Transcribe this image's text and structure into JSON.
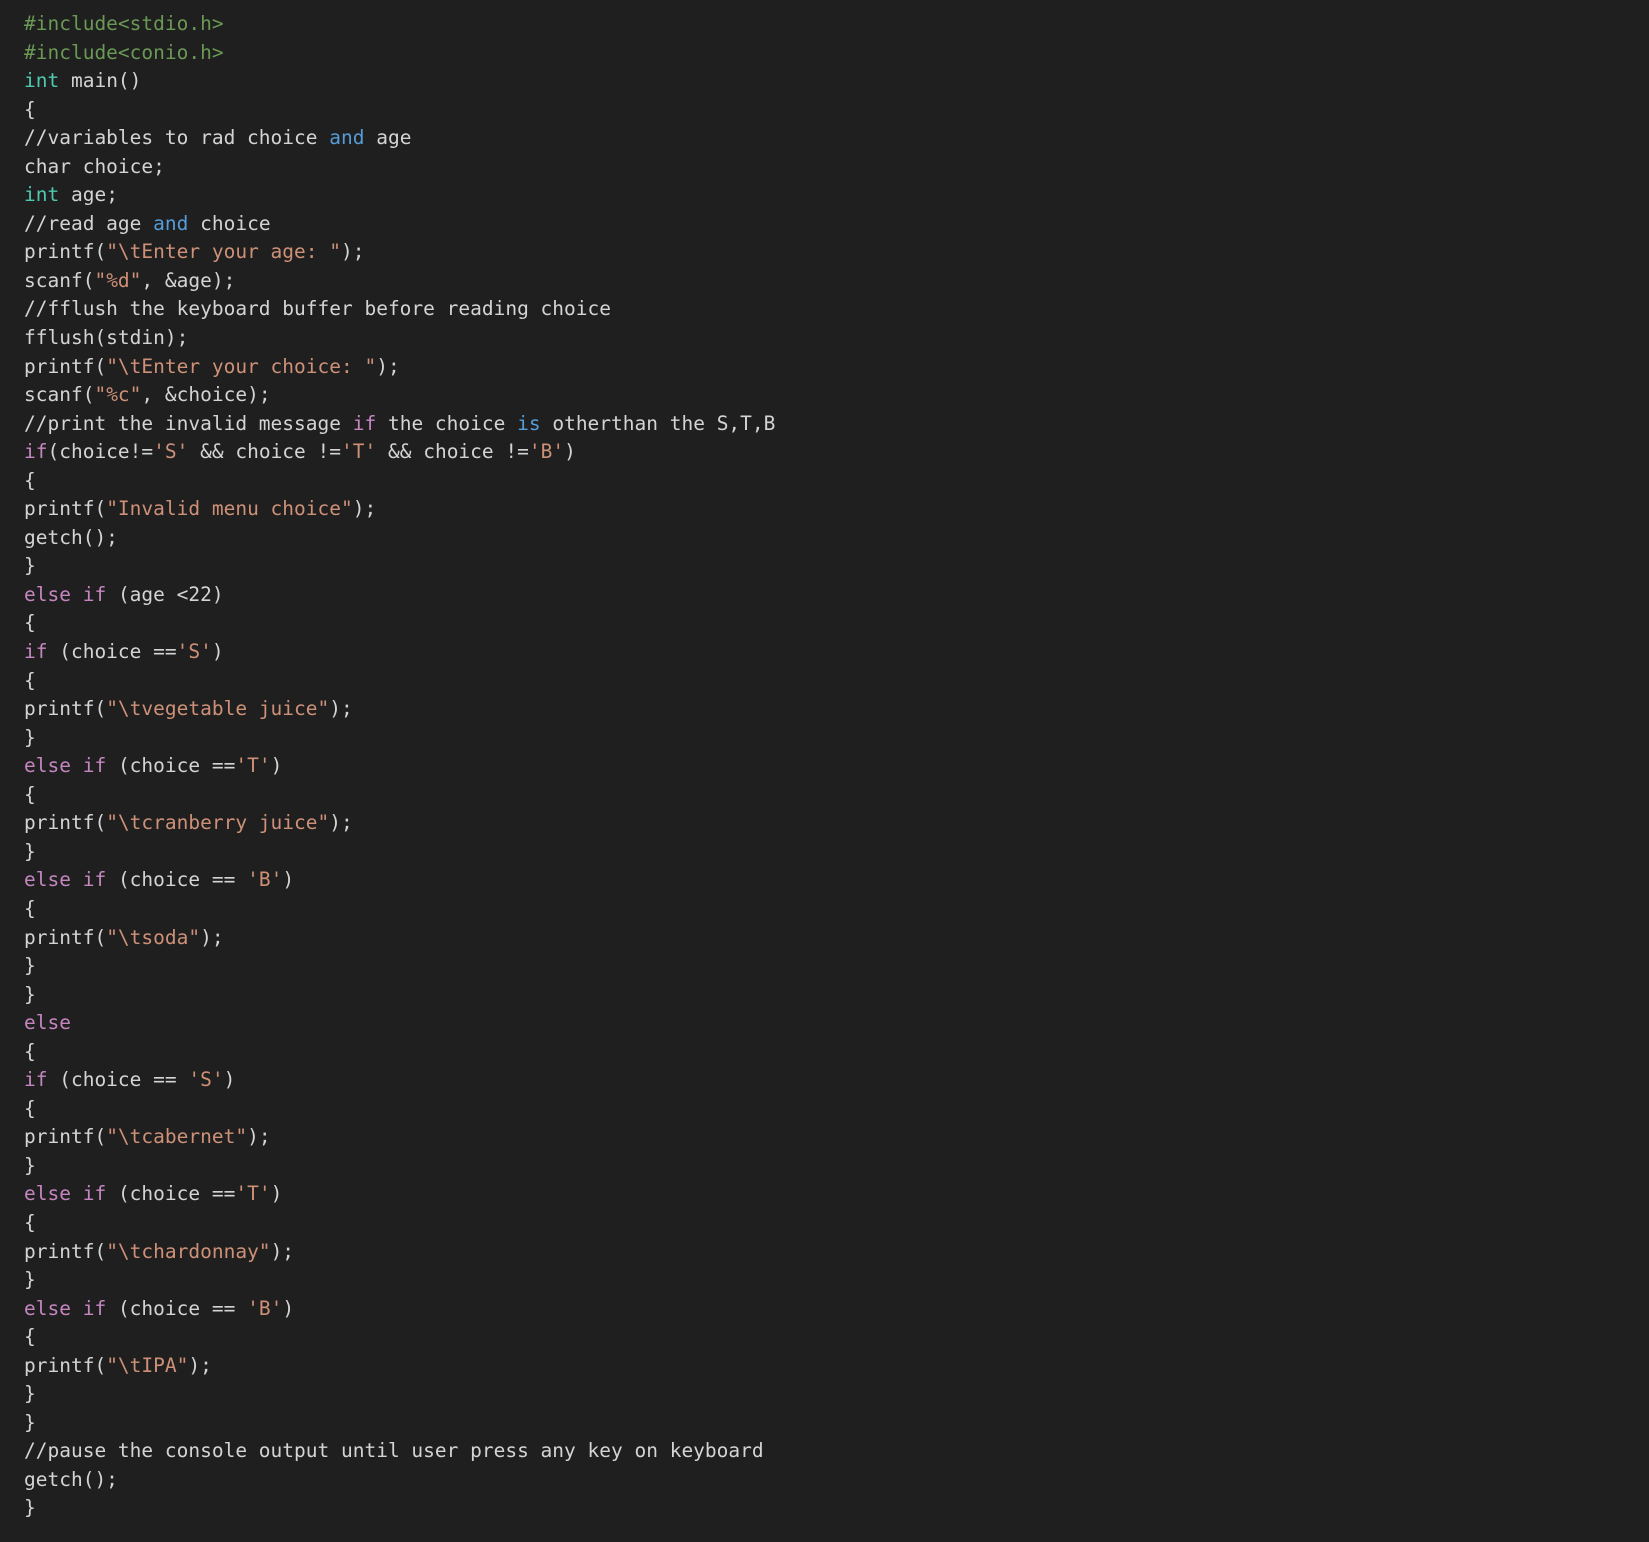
{
  "theme": {
    "background": "#1f1f1f",
    "default_text": "#d4d4d4",
    "preprocessor": "#6a9955",
    "type": "#4ec9b0",
    "keyword": "#c586c0",
    "word_operator": "#569cd6",
    "string": "#ce9178"
  },
  "code_lines": [
    [
      {
        "t": "#include<stdio.h>",
        "k": "preproc"
      }
    ],
    [
      {
        "t": "#include<conio.h>",
        "k": "preproc"
      }
    ],
    [
      {
        "t": "int",
        "k": "type"
      },
      {
        "t": " main()",
        "k": "plain"
      }
    ],
    [
      {
        "t": "{",
        "k": "plain"
      }
    ],
    [
      {
        "t": "//variables to rad choice ",
        "k": "plain"
      },
      {
        "t": "and",
        "k": "operator-word"
      },
      {
        "t": " age",
        "k": "plain"
      }
    ],
    [
      {
        "t": "char choice;",
        "k": "plain"
      }
    ],
    [
      {
        "t": "int",
        "k": "type"
      },
      {
        "t": " age;",
        "k": "plain"
      }
    ],
    [
      {
        "t": "//read age ",
        "k": "plain"
      },
      {
        "t": "and",
        "k": "operator-word"
      },
      {
        "t": " choice",
        "k": "plain"
      }
    ],
    [
      {
        "t": "printf(",
        "k": "plain"
      },
      {
        "t": "\"\\tEnter your age: \"",
        "k": "string"
      },
      {
        "t": ");",
        "k": "plain"
      }
    ],
    [
      {
        "t": "scanf(",
        "k": "plain"
      },
      {
        "t": "\"%d\"",
        "k": "string"
      },
      {
        "t": ", &age);",
        "k": "plain"
      }
    ],
    [
      {
        "t": "//fflush the keyboard buffer before reading choice",
        "k": "plain"
      }
    ],
    [
      {
        "t": "fflush(stdin);",
        "k": "plain"
      }
    ],
    [
      {
        "t": "printf(",
        "k": "plain"
      },
      {
        "t": "\"\\tEnter your choice: \"",
        "k": "string"
      },
      {
        "t": ");",
        "k": "plain"
      }
    ],
    [
      {
        "t": "scanf(",
        "k": "plain"
      },
      {
        "t": "\"%c\"",
        "k": "string"
      },
      {
        "t": ", &choice);",
        "k": "plain"
      }
    ],
    [
      {
        "t": "//print the invalid message ",
        "k": "plain"
      },
      {
        "t": "if",
        "k": "keyword"
      },
      {
        "t": " the choice ",
        "k": "plain"
      },
      {
        "t": "is",
        "k": "operator-word"
      },
      {
        "t": " otherthan the S,T,B",
        "k": "plain"
      }
    ],
    [
      {
        "t": "if",
        "k": "keyword"
      },
      {
        "t": "(choice!=",
        "k": "plain"
      },
      {
        "t": "'S'",
        "k": "string"
      },
      {
        "t": " && choice !=",
        "k": "plain"
      },
      {
        "t": "'T'",
        "k": "string"
      },
      {
        "t": " && choice !=",
        "k": "plain"
      },
      {
        "t": "'B'",
        "k": "string"
      },
      {
        "t": ")",
        "k": "plain"
      }
    ],
    [
      {
        "t": "{",
        "k": "plain"
      }
    ],
    [
      {
        "t": "printf(",
        "k": "plain"
      },
      {
        "t": "\"Invalid menu choice\"",
        "k": "string"
      },
      {
        "t": ");",
        "k": "plain"
      }
    ],
    [
      {
        "t": "getch();",
        "k": "plain"
      }
    ],
    [
      {
        "t": "}",
        "k": "plain"
      }
    ],
    [
      {
        "t": "else",
        "k": "keyword"
      },
      {
        "t": " ",
        "k": "plain"
      },
      {
        "t": "if",
        "k": "keyword"
      },
      {
        "t": " (age <22)",
        "k": "plain"
      }
    ],
    [
      {
        "t": "{",
        "k": "plain"
      }
    ],
    [
      {
        "t": "if",
        "k": "keyword"
      },
      {
        "t": " (choice ==",
        "k": "plain"
      },
      {
        "t": "'S'",
        "k": "string"
      },
      {
        "t": ")",
        "k": "plain"
      }
    ],
    [
      {
        "t": "{",
        "k": "plain"
      }
    ],
    [
      {
        "t": "printf(",
        "k": "plain"
      },
      {
        "t": "\"\\tvegetable juice\"",
        "k": "string"
      },
      {
        "t": ");",
        "k": "plain"
      }
    ],
    [
      {
        "t": "}",
        "k": "plain"
      }
    ],
    [
      {
        "t": "else",
        "k": "keyword"
      },
      {
        "t": " ",
        "k": "plain"
      },
      {
        "t": "if",
        "k": "keyword"
      },
      {
        "t": " (choice ==",
        "k": "plain"
      },
      {
        "t": "'T'",
        "k": "string"
      },
      {
        "t": ")",
        "k": "plain"
      }
    ],
    [
      {
        "t": "{",
        "k": "plain"
      }
    ],
    [
      {
        "t": "printf(",
        "k": "plain"
      },
      {
        "t": "\"\\tcranberry juice\"",
        "k": "string"
      },
      {
        "t": ");",
        "k": "plain"
      }
    ],
    [
      {
        "t": "}",
        "k": "plain"
      }
    ],
    [
      {
        "t": "else",
        "k": "keyword"
      },
      {
        "t": " ",
        "k": "plain"
      },
      {
        "t": "if",
        "k": "keyword"
      },
      {
        "t": " (choice == ",
        "k": "plain"
      },
      {
        "t": "'B'",
        "k": "string"
      },
      {
        "t": ")",
        "k": "plain"
      }
    ],
    [
      {
        "t": "{",
        "k": "plain"
      }
    ],
    [
      {
        "t": "printf(",
        "k": "plain"
      },
      {
        "t": "\"\\tsoda\"",
        "k": "string"
      },
      {
        "t": ");",
        "k": "plain"
      }
    ],
    [
      {
        "t": "}",
        "k": "plain"
      }
    ],
    [
      {
        "t": "}",
        "k": "plain"
      }
    ],
    [
      {
        "t": "else",
        "k": "keyword"
      }
    ],
    [
      {
        "t": "{",
        "k": "plain"
      }
    ],
    [
      {
        "t": "if",
        "k": "keyword"
      },
      {
        "t": " (choice == ",
        "k": "plain"
      },
      {
        "t": "'S'",
        "k": "string"
      },
      {
        "t": ")",
        "k": "plain"
      }
    ],
    [
      {
        "t": "{",
        "k": "plain"
      }
    ],
    [
      {
        "t": "printf(",
        "k": "plain"
      },
      {
        "t": "\"\\tcabernet\"",
        "k": "string"
      },
      {
        "t": ");",
        "k": "plain"
      }
    ],
    [
      {
        "t": "}",
        "k": "plain"
      }
    ],
    [
      {
        "t": "else",
        "k": "keyword"
      },
      {
        "t": " ",
        "k": "plain"
      },
      {
        "t": "if",
        "k": "keyword"
      },
      {
        "t": " (choice ==",
        "k": "plain"
      },
      {
        "t": "'T'",
        "k": "string"
      },
      {
        "t": ")",
        "k": "plain"
      }
    ],
    [
      {
        "t": "{",
        "k": "plain"
      }
    ],
    [
      {
        "t": "printf(",
        "k": "plain"
      },
      {
        "t": "\"\\tchardonnay\"",
        "k": "string"
      },
      {
        "t": ");",
        "k": "plain"
      }
    ],
    [
      {
        "t": "}",
        "k": "plain"
      }
    ],
    [
      {
        "t": "else",
        "k": "keyword"
      },
      {
        "t": " ",
        "k": "plain"
      },
      {
        "t": "if",
        "k": "keyword"
      },
      {
        "t": " (choice == ",
        "k": "plain"
      },
      {
        "t": "'B'",
        "k": "string"
      },
      {
        "t": ")",
        "k": "plain"
      }
    ],
    [
      {
        "t": "{",
        "k": "plain"
      }
    ],
    [
      {
        "t": "printf(",
        "k": "plain"
      },
      {
        "t": "\"\\tIPA\"",
        "k": "string"
      },
      {
        "t": ");",
        "k": "plain"
      }
    ],
    [
      {
        "t": "}",
        "k": "plain"
      }
    ],
    [
      {
        "t": "}",
        "k": "plain"
      }
    ],
    [
      {
        "t": "//pause the console output until user press any key on keyboard",
        "k": "plain"
      }
    ],
    [
      {
        "t": "getch();",
        "k": "plain"
      }
    ],
    [
      {
        "t": "}",
        "k": "plain"
      }
    ]
  ]
}
